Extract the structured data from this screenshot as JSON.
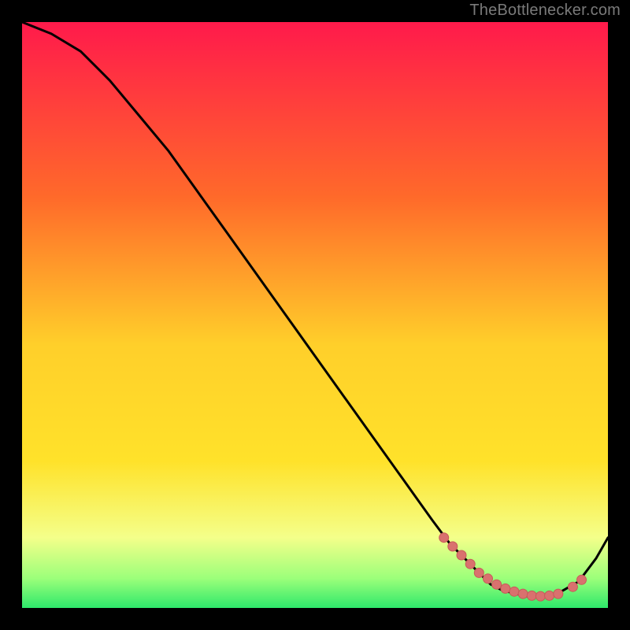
{
  "watermark": "TheBottlenecker.com",
  "colors": {
    "bg_black": "#000000",
    "grad_top": "#ff1a4b",
    "grad_mid_top": "#ff8a2a",
    "grad_mid": "#ffe22a",
    "grad_low": "#f6ff7a",
    "grad_green": "#2ee86b",
    "line": "#000000",
    "marker_fill": "#d9716e",
    "marker_stroke": "#c85a58",
    "wm": "#7a7a7a"
  },
  "chart_data": {
    "type": "line",
    "title": "",
    "xlabel": "",
    "ylabel": "",
    "xlim": [
      0,
      100
    ],
    "ylim": [
      0,
      100
    ],
    "x": [
      0,
      5,
      10,
      15,
      20,
      25,
      30,
      35,
      40,
      45,
      50,
      55,
      60,
      65,
      70,
      73,
      75,
      78,
      80,
      82,
      84,
      86,
      88,
      90,
      92,
      95,
      98,
      100
    ],
    "values": [
      100,
      98,
      95,
      90,
      84,
      78,
      71,
      64,
      57,
      50,
      43,
      36,
      29,
      22,
      15,
      11,
      9,
      6,
      4,
      3,
      2.5,
      2,
      2,
      2.2,
      2.8,
      4.5,
      8.5,
      12
    ],
    "markers": {
      "x": [
        72,
        73.5,
        75,
        76.5,
        78,
        79.5,
        81,
        82.5,
        84,
        85.5,
        87,
        88.5,
        90,
        91.5,
        94,
        95.5
      ],
      "values": [
        12,
        10.5,
        9,
        7.5,
        6,
        5,
        4,
        3.3,
        2.8,
        2.4,
        2.1,
        2,
        2.1,
        2.4,
        3.6,
        4.8
      ]
    }
  }
}
